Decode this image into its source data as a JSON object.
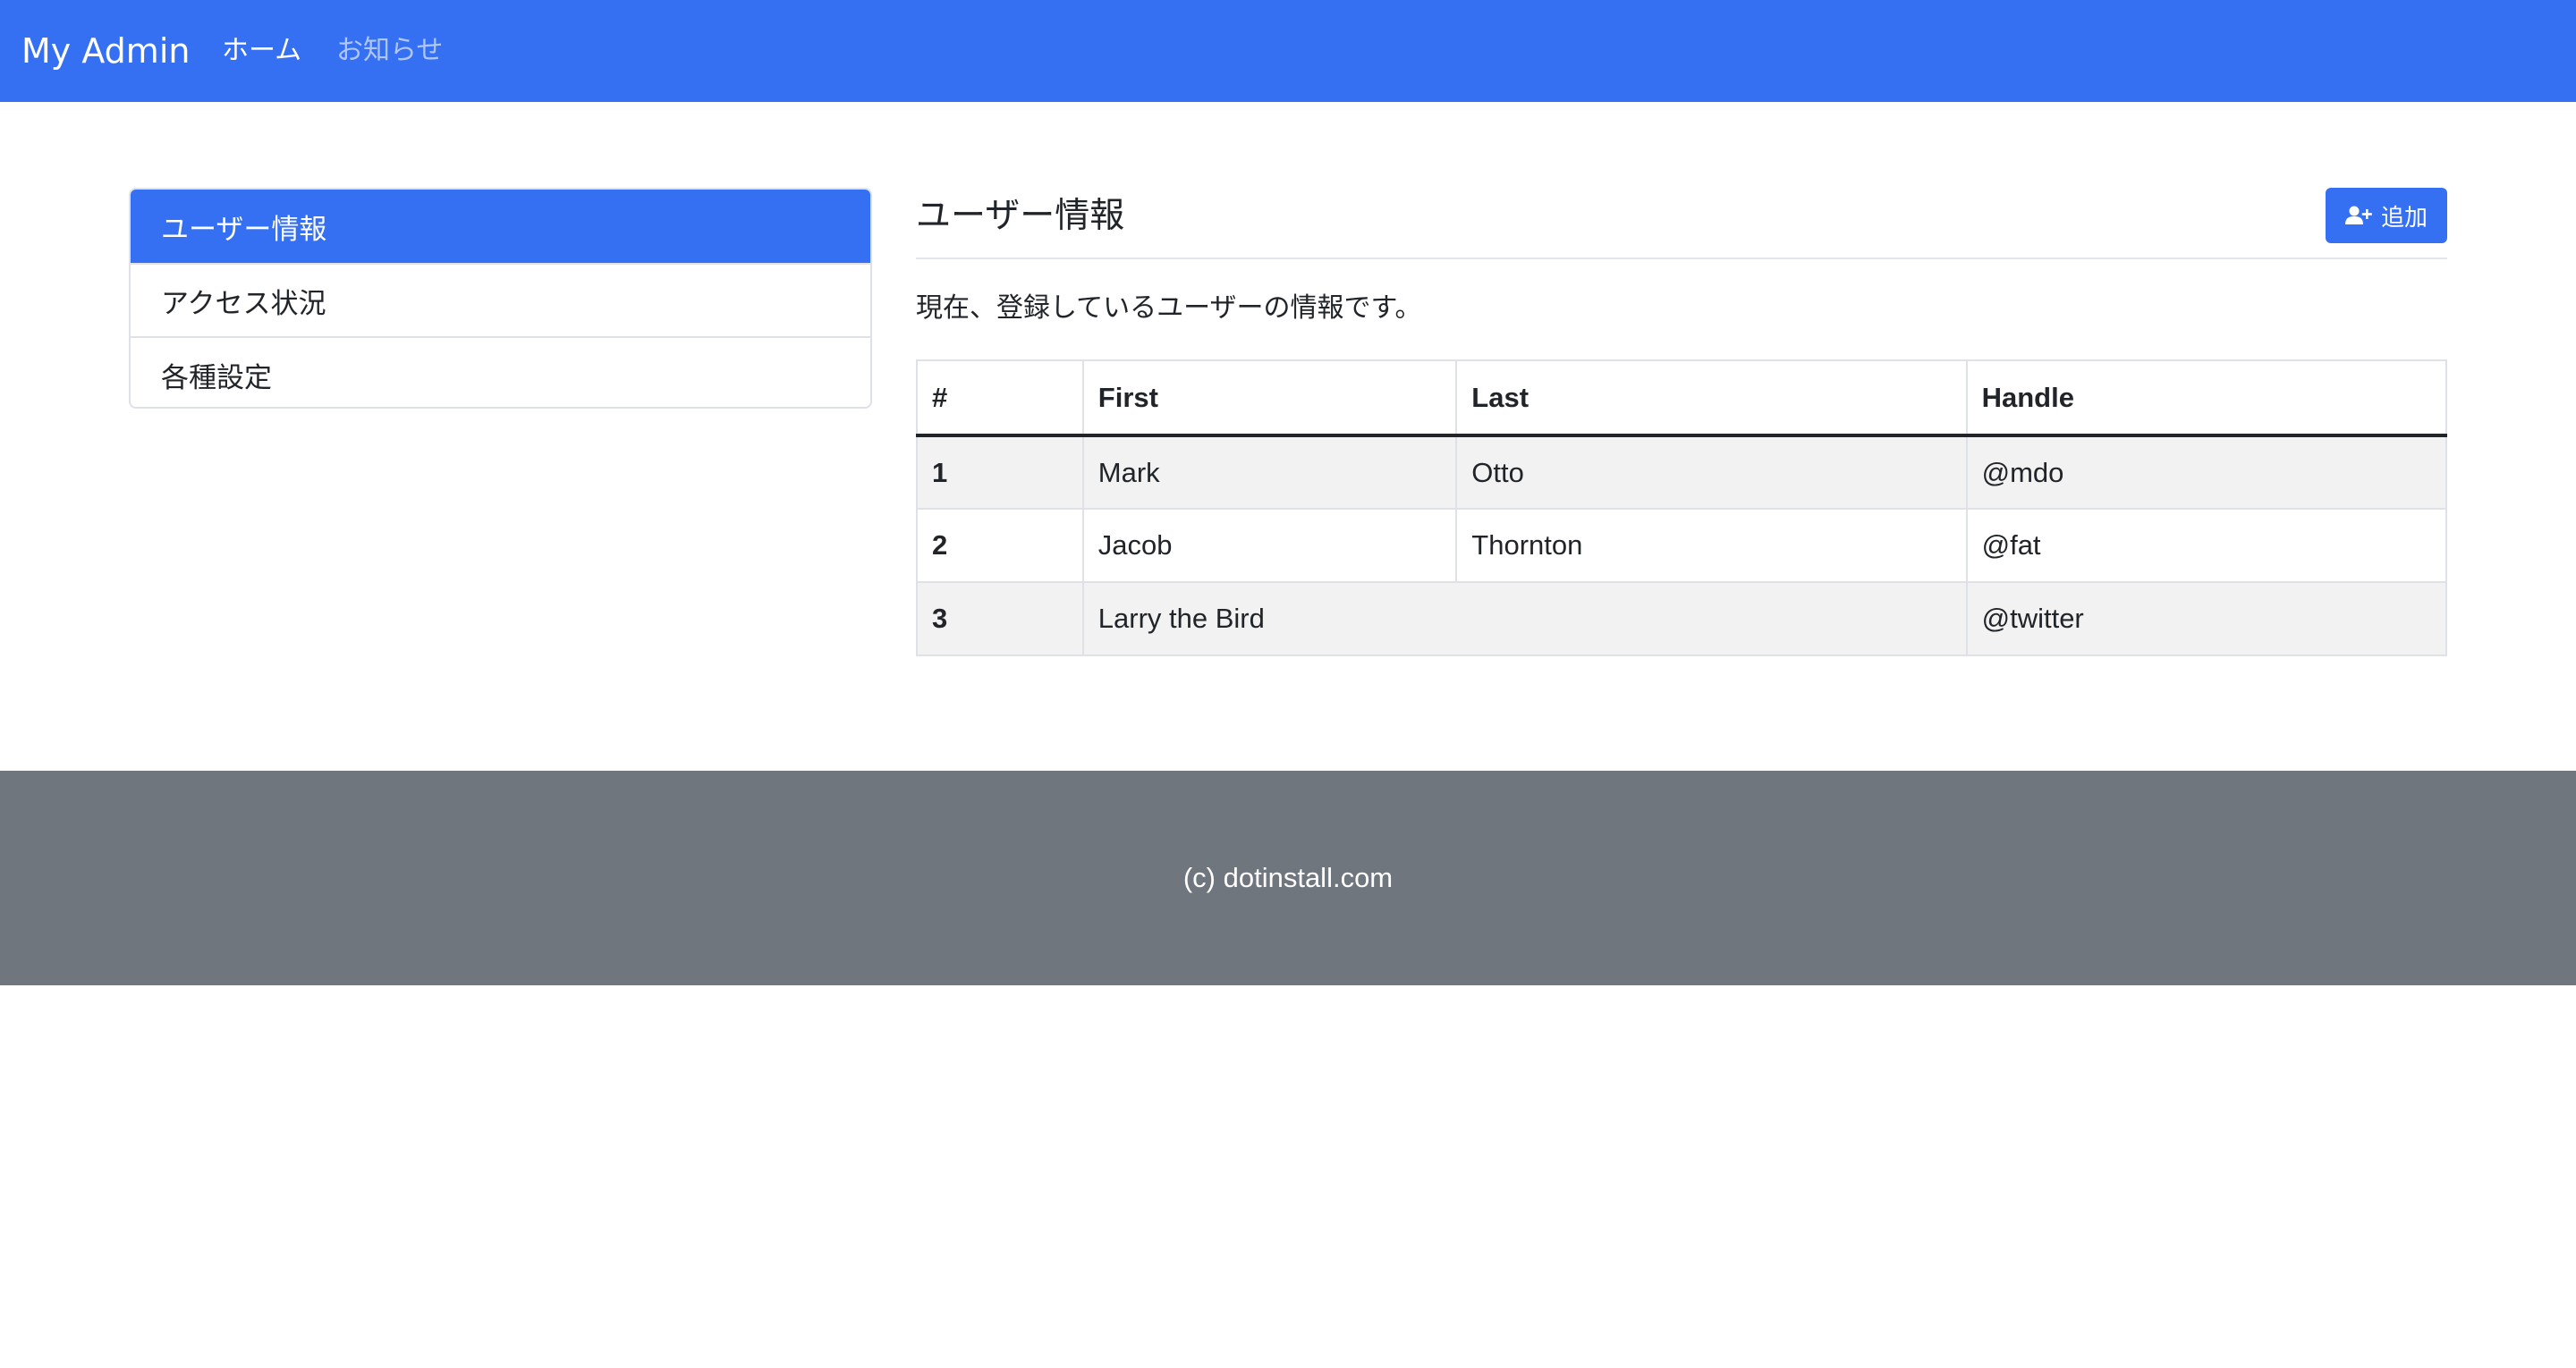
{
  "navbar": {
    "brand": "My Admin",
    "links": [
      {
        "label": "ホーム",
        "active": true
      },
      {
        "label": "お知らせ",
        "active": false
      }
    ],
    "background_color": "#3570f3"
  },
  "sidebar": {
    "items": [
      {
        "label": "ユーザー情報",
        "active": true
      },
      {
        "label": "アクセス状況",
        "active": false
      },
      {
        "label": "各種設定",
        "active": false
      }
    ]
  },
  "main": {
    "title": "ユーザー情報",
    "add_button": {
      "label": "追加",
      "icon": "person-plus-icon"
    },
    "description": "現在、登録しているユーザーの情報です。",
    "table": {
      "headers": [
        "#",
        "First",
        "Last",
        "Handle"
      ],
      "rows": [
        {
          "id": "1",
          "first": "Mark",
          "last": "Otto",
          "handle": "@mdo"
        },
        {
          "id": "2",
          "first": "Jacob",
          "last": "Thornton",
          "handle": "@fat"
        },
        {
          "id": "3",
          "first_last": "Larry the Bird",
          "handle": "@twitter"
        }
      ]
    }
  },
  "footer": {
    "text": "(c) dotinstall.com",
    "background_color": "#6f767e"
  }
}
